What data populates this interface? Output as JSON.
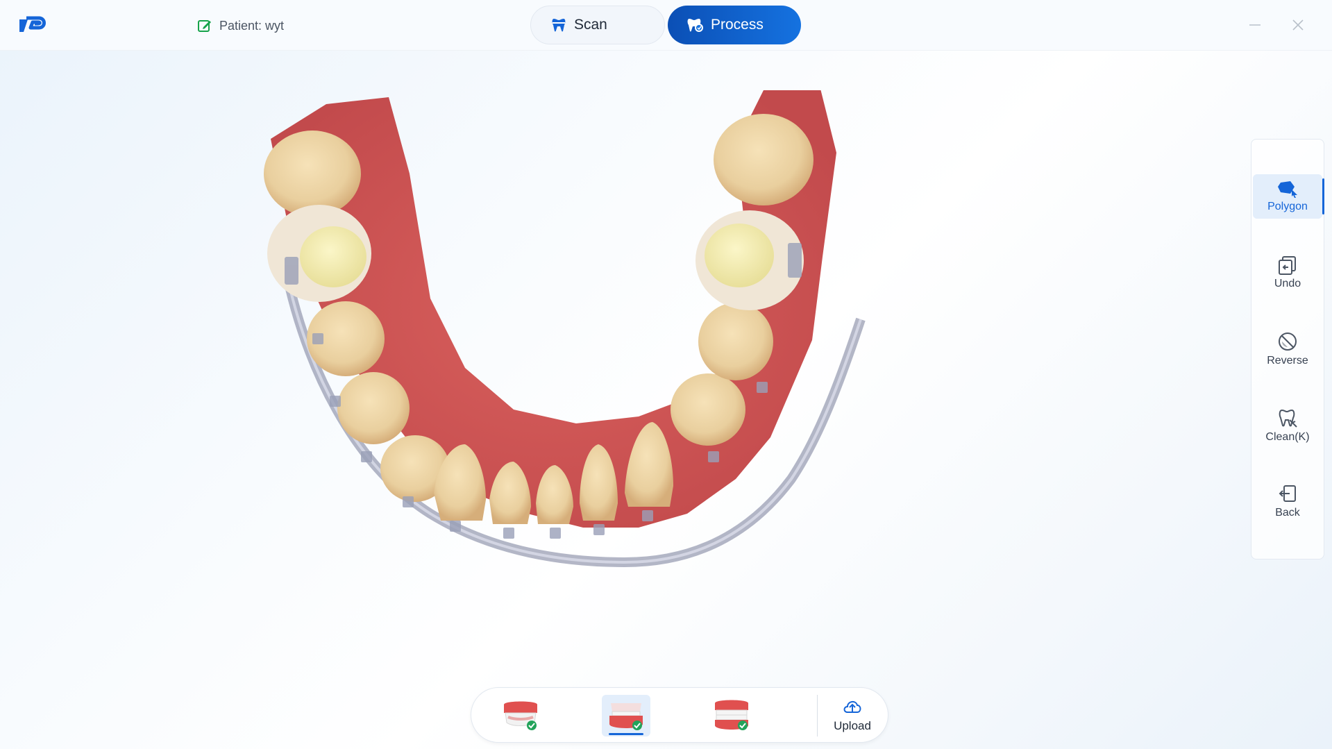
{
  "app": {
    "brand_color": "#1565d8"
  },
  "header": {
    "patient_label": "Patient: wyt",
    "tabs": [
      {
        "label": "Scan",
        "active": false
      },
      {
        "label": "Process",
        "active": true
      }
    ],
    "icons": {
      "patient": "edit-icon",
      "scan": "tooth-scan-icon",
      "process": "tooth-process-icon"
    }
  },
  "toolbar": {
    "items": [
      {
        "label": "Polygon",
        "icon": "polygon-select-icon",
        "active": true
      },
      {
        "label": "Undo",
        "icon": "undo-icon",
        "active": false
      },
      {
        "label": "Reverse",
        "icon": "reverse-icon",
        "active": false
      },
      {
        "label": "Clean(K)",
        "icon": "clean-icon",
        "active": false
      },
      {
        "label": "Back",
        "icon": "back-icon",
        "active": false
      }
    ]
  },
  "bottom": {
    "jaws": [
      {
        "name": "upper-jaw",
        "status": "done",
        "selected": false
      },
      {
        "name": "lower-jaw",
        "status": "done",
        "selected": true
      },
      {
        "name": "bite",
        "status": "done",
        "selected": false
      }
    ],
    "upload_label": "Upload",
    "upload_icon": "cloud-upload-icon"
  }
}
